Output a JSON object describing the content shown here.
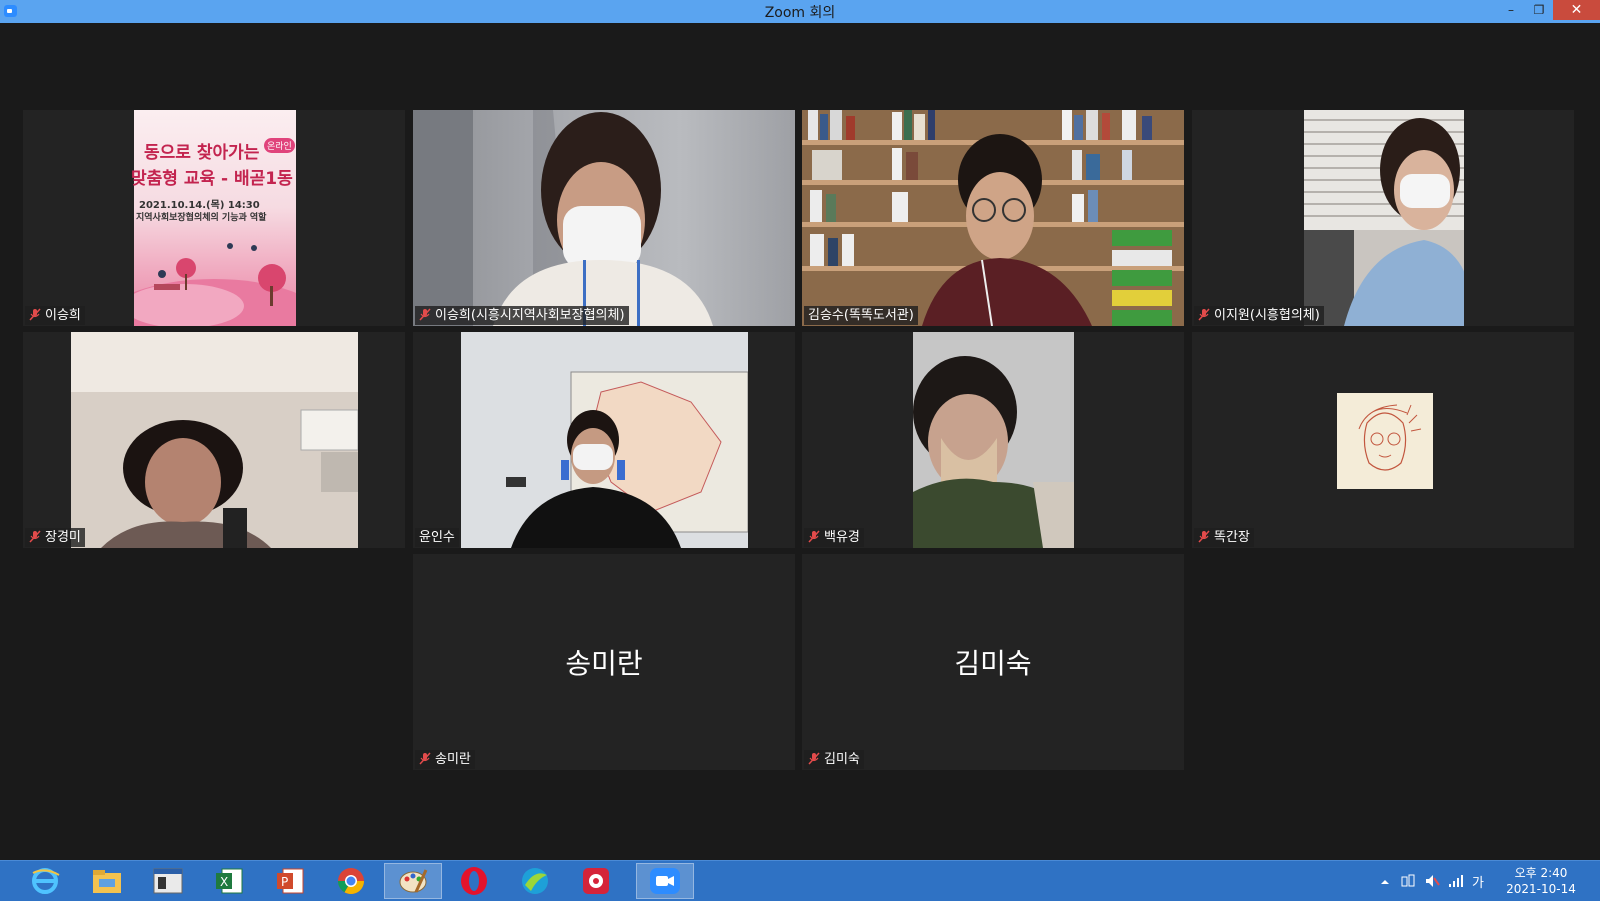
{
  "window": {
    "title": "Zoom 회의",
    "minimize_glyph": "–",
    "restore_glyph": "❐",
    "close_glyph": "✕"
  },
  "participants": [
    {
      "name": "이승희",
      "muted": true,
      "view": "poster",
      "poster": {
        "line1": "동으로 찾아가는",
        "line2": "맞춤형 교육 - 배곧1동",
        "badge": "온라인",
        "date": "2021.10.14.(목) 14:30",
        "subtitle": "지역사회보장협의체의 기능과 역할"
      }
    },
    {
      "name": "이승희(시흥시지역사회보장협의체)",
      "muted": true,
      "view": "video"
    },
    {
      "name": "김승수(똑똑도서관)",
      "muted": false,
      "view": "video",
      "active": true
    },
    {
      "name": "이지원(시흥협의체)",
      "muted": true,
      "view": "video"
    },
    {
      "name": "장경미",
      "muted": true,
      "view": "video"
    },
    {
      "name": "윤인수",
      "muted": false,
      "view": "video"
    },
    {
      "name": "백유경",
      "muted": true,
      "view": "video"
    },
    {
      "name": "똑간장",
      "muted": true,
      "view": "avatar"
    },
    {
      "name": "송미란",
      "muted": true,
      "view": "name"
    },
    {
      "name": "김미숙",
      "muted": true,
      "view": "name"
    }
  ],
  "taskbar": {
    "apps": [
      "ie-icon",
      "file-explorer-icon",
      "window-icon",
      "excel-icon",
      "powerpoint-icon",
      "chrome-icon",
      "paint-icon",
      "opera-icon",
      "swift-icon",
      "app-red-icon",
      "zoom-icon"
    ],
    "ime": "가",
    "clock_time": "오후 2:40",
    "clock_date": "2021-10-14"
  }
}
